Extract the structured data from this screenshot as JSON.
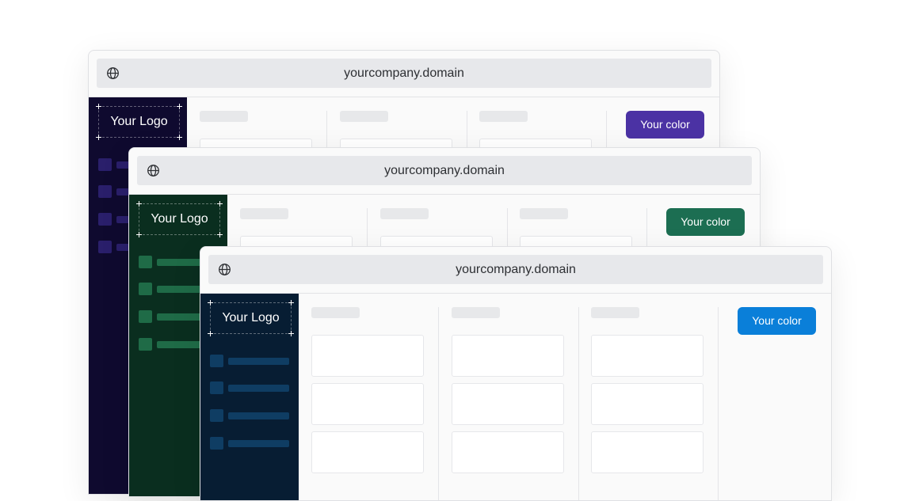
{
  "windows": [
    {
      "url": "yourcompany.domain",
      "logo_text": "Your Logo",
      "button_label": "Your color",
      "sidebar_color": "#0f0a2f",
      "nav_color": "#2a1f6b",
      "button_color": "#4b32a4"
    },
    {
      "url": "yourcompany.domain",
      "logo_text": "Your Logo",
      "button_label": "Your color",
      "sidebar_color": "#0a2e1f",
      "nav_color": "#1f6b47",
      "button_color": "#1c6e52"
    },
    {
      "url": "yourcompany.domain",
      "logo_text": "Your Logo",
      "button_label": "Your color",
      "sidebar_color": "#071d33",
      "nav_color": "#0f3d63",
      "button_color": "#0a7fd9"
    }
  ]
}
